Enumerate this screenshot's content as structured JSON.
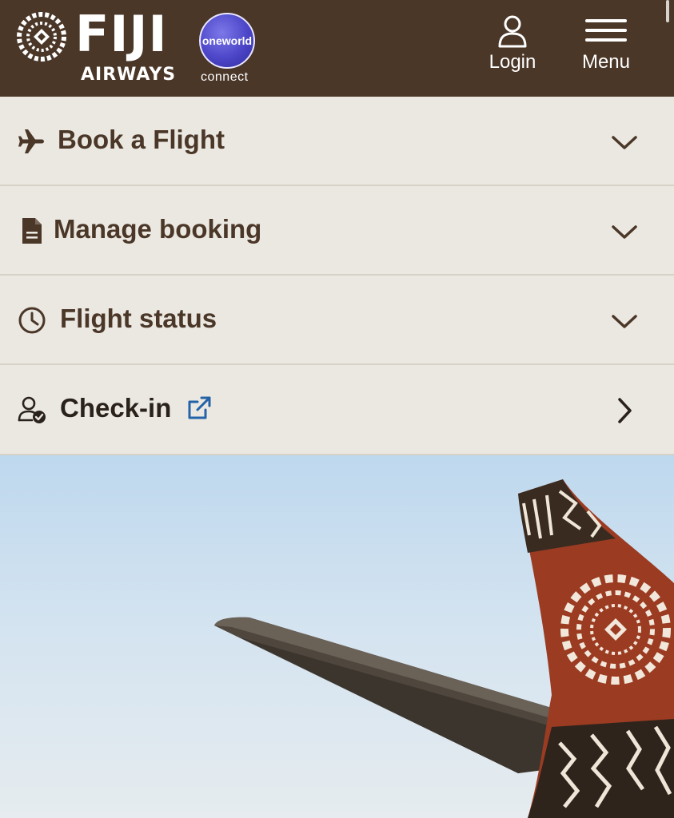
{
  "header": {
    "brand_name": "FIJI",
    "brand_sub": "AIRWAYS",
    "alliance_badge": "oneworld",
    "alliance_sub": "connect",
    "login_label": "Login",
    "menu_label": "Menu",
    "background_color": "#4a3728"
  },
  "accordion": {
    "items": [
      {
        "label": "Book a Flight",
        "icon": "airplane-icon",
        "indicator": "chevron-down-icon"
      },
      {
        "label": "Manage booking",
        "icon": "document-icon",
        "indicator": "chevron-down-icon"
      },
      {
        "label": "Flight status",
        "icon": "clock-icon",
        "indicator": "chevron-down-icon"
      },
      {
        "label": "Check-in",
        "icon": "user-check-icon",
        "indicator": "chevron-right-icon",
        "external": true
      }
    ],
    "background_color": "#ebe8e2",
    "text_color": "#4a3728",
    "external_link_color": "#2563a8"
  }
}
